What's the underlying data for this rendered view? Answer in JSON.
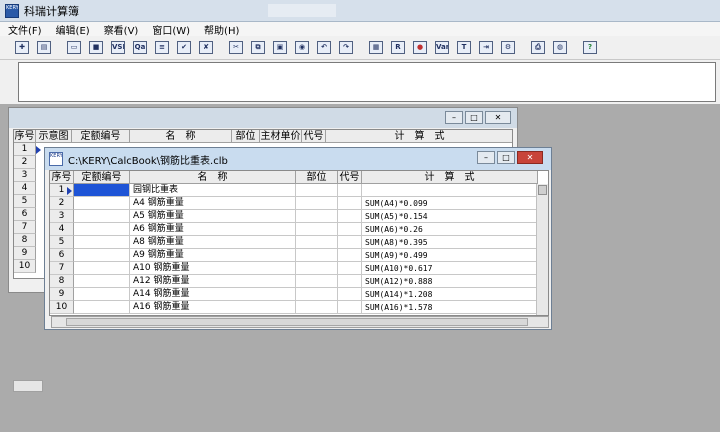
{
  "app": {
    "title": "科瑞计算簿",
    "icon": "kery-app-icon"
  },
  "menu": [
    {
      "label": "文件(F)"
    },
    {
      "label": "编辑(E)"
    },
    {
      "label": "察看(V)"
    },
    {
      "label": "窗口(W)"
    },
    {
      "label": "帮助(H)"
    }
  ],
  "toolbar": {
    "icons": [
      "new-icon",
      "open-icon",
      "save-as-icon",
      "save-icon",
      "vsb-icon",
      "qa-icon",
      "insert-row-icon",
      "check-icon",
      "delete-icon",
      "cut-icon",
      "copy-icon",
      "paste-icon",
      "find-icon",
      "undo-icon",
      "redo-icon",
      "calc-icon",
      "r-icon",
      "color-icon",
      "var-icon",
      "text-icon",
      "dec-icon",
      "print-setup-icon",
      "print-icon",
      "preview-icon",
      "help-icon"
    ],
    "labels": {
      "vsb": "VSB",
      "qa": "Qa",
      "r": "R",
      "var": "Var",
      "text": "T",
      "help": "?"
    }
  },
  "win1": {
    "headers": [
      "序号",
      "示意图",
      "定额编号",
      "名　称",
      "部位",
      "主材单价",
      "代号",
      "计　算　式"
    ],
    "rows": [
      "1",
      "2",
      "3",
      "4",
      "5",
      "6",
      "7",
      "8",
      "9",
      "10"
    ]
  },
  "win2": {
    "title": "C:\\KERY\\CalcBook\\钢筋比重表.clb",
    "headers": [
      "序号",
      "定额编号",
      "名　称",
      "部位",
      "代号",
      "计　算　式"
    ],
    "rows": [
      {
        "n": "1",
        "name": "园钢比重表",
        "formula": ""
      },
      {
        "n": "2",
        "name": "A4 钢筋重量",
        "formula": "SUM(A4)*0.099"
      },
      {
        "n": "3",
        "name": "A5 钢筋重量",
        "formula": "SUM(A5)*0.154"
      },
      {
        "n": "4",
        "name": "A6 钢筋重量",
        "formula": "SUM(A6)*0.26"
      },
      {
        "n": "5",
        "name": "A8 钢筋重量",
        "formula": "SUM(A8)*0.395"
      },
      {
        "n": "6",
        "name": "A9 钢筋重量",
        "formula": "SUM(A9)*0.499"
      },
      {
        "n": "7",
        "name": "A10 钢筋重量",
        "formula": "SUM(A10)*0.617"
      },
      {
        "n": "8",
        "name": "A12 钢筋重量",
        "formula": "SUM(A12)*0.888"
      },
      {
        "n": "9",
        "name": "A14 钢筋重量",
        "formula": "SUM(A14)*1.208"
      },
      {
        "n": "10",
        "name": "A16 钢筋重量",
        "formula": "SUM(A16)*1.578"
      }
    ]
  },
  "colors": {
    "selection": "#1e54d6",
    "titlebar": "#d6e0eb"
  }
}
